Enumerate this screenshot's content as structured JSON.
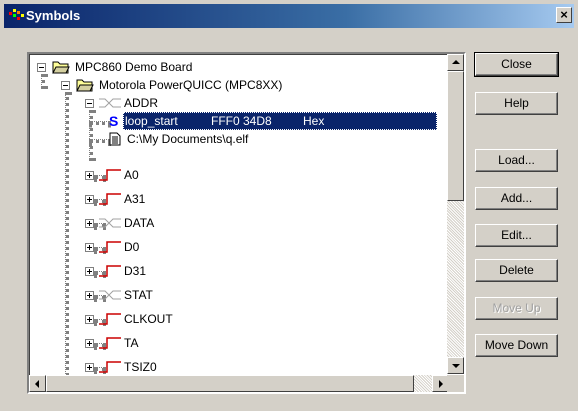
{
  "window": {
    "title": "Symbols"
  },
  "tree": {
    "root": "MPC860 Demo Board",
    "child": "Motorola PowerQUICC (MPC8XX)",
    "addr": "ADDR",
    "symbol": {
      "glyph": "S",
      "name": "loop_start",
      "value": "FFF0 34D8",
      "format": "Hex"
    },
    "file": "C:\\My Documents\\q.elf",
    "signals": [
      {
        "label": "A0",
        "kind": "signal"
      },
      {
        "label": "A31",
        "kind": "signal"
      },
      {
        "label": "DATA",
        "kind": "bus"
      },
      {
        "label": "D0",
        "kind": "signal"
      },
      {
        "label": "D31",
        "kind": "signal"
      },
      {
        "label": "STAT",
        "kind": "bus"
      },
      {
        "label": "CLKOUT",
        "kind": "signal"
      },
      {
        "label": "TA",
        "kind": "signal"
      },
      {
        "label": "TSIZ0",
        "kind": "signal"
      }
    ]
  },
  "buttons": {
    "close": "Close",
    "help": "Help",
    "load": "Load...",
    "add": "Add...",
    "edit": "Edit...",
    "delete": "Delete",
    "move_up": "Move Up",
    "move_down": "Move Down"
  },
  "colors": {
    "selection": "#0a246a",
    "signal": "#cc0000",
    "symbol_glyph": "#0000ff"
  }
}
